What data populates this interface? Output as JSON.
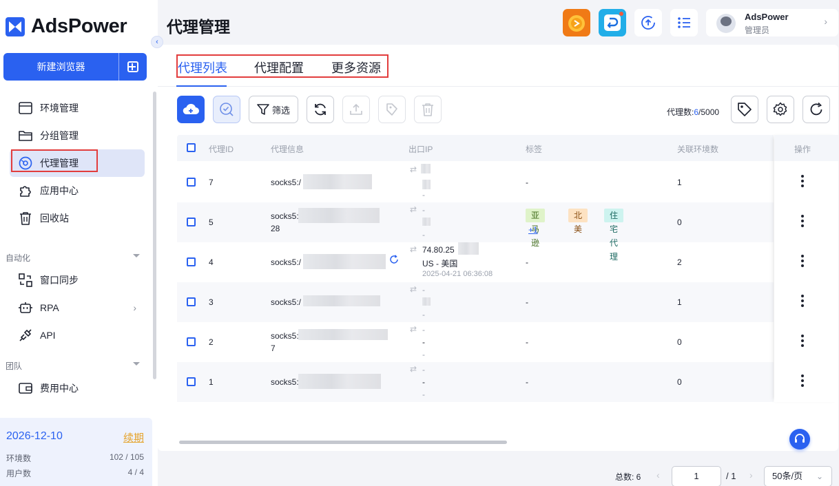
{
  "app": {
    "logo_text": "AdsPower",
    "brand_color": "#2a61f0"
  },
  "sidebar": {
    "new_browser_label": "新建浏览器",
    "items": [
      {
        "label": "环境管理",
        "icon": "browser-window-icon"
      },
      {
        "label": "分组管理",
        "icon": "folder-icon"
      },
      {
        "label": "代理管理",
        "icon": "proxy-globe-icon",
        "active": true
      },
      {
        "label": "应用中心",
        "icon": "puzzle-icon"
      },
      {
        "label": "回收站",
        "icon": "trash-icon"
      }
    ],
    "section_automation": "自动化",
    "automation_items": [
      {
        "label": "窗口同步",
        "icon": "window-sync-icon"
      },
      {
        "label": "RPA",
        "icon": "robot-icon"
      },
      {
        "label": "API",
        "icon": "plug-icon"
      }
    ],
    "section_team": "团队",
    "team_items": [
      {
        "label": "费用中心",
        "icon": "wallet-icon"
      }
    ],
    "plan": {
      "expiry_date": "2026-12-10",
      "renew_label": "续期",
      "env_label": "环境数",
      "env_value": "102 / 105",
      "user_label": "用户数",
      "user_value": "4 / 4"
    }
  },
  "header": {
    "title": "代理管理",
    "user_name": "AdsPower",
    "user_role": "管理员"
  },
  "tabs": [
    {
      "label": "代理列表",
      "active": true
    },
    {
      "label": "代理配置"
    },
    {
      "label": "更多资源"
    }
  ],
  "toolbar": {
    "filter_label": "筛选",
    "proxy_count_label": "代理数:",
    "proxy_count_used": "6",
    "proxy_count_total": "/5000"
  },
  "table": {
    "columns": [
      "代理ID",
      "代理信息",
      "出口IP",
      "标签",
      "关联环境数",
      "操作"
    ],
    "rows": [
      {
        "id": "7",
        "info": "socks5:/",
        "info2": "",
        "ip_lines": [
          "",
          "",
          "-"
        ],
        "tags": [],
        "tags_text": "-",
        "envs": "1"
      },
      {
        "id": "5",
        "info": "socks5:",
        "info2": "28",
        "ip_lines": [
          "-",
          "",
          "-"
        ],
        "tags": [
          "亚马逊",
          "北美",
          "住宅代理"
        ],
        "tags_more": "+1",
        "envs": "0"
      },
      {
        "id": "4",
        "info": "socks5:/",
        "info2": "",
        "ip_lines": [
          "74.80.25",
          "US - 美国",
          "2025-04-21 06:36:08"
        ],
        "tags": [],
        "tags_text": "-",
        "envs": "2"
      },
      {
        "id": "3",
        "info": "socks5:/",
        "info2": "",
        "ip_lines": [
          "-",
          "",
          "-"
        ],
        "tags": [],
        "tags_text": "-",
        "envs": "1"
      },
      {
        "id": "2",
        "info": "socks5:",
        "info2": "7",
        "ip_lines": [
          "-",
          "-",
          "-"
        ],
        "tags": [],
        "tags_text": "-",
        "envs": "0"
      },
      {
        "id": "1",
        "info": "socks5:",
        "info2": "",
        "ip_lines": [
          "-",
          "-",
          "-"
        ],
        "tags": [],
        "tags_text": "-",
        "envs": "0"
      }
    ]
  },
  "pagination": {
    "total_label": "总数: 6",
    "current_page": "1",
    "of_pages": "/ 1",
    "page_size": "50条/页"
  }
}
